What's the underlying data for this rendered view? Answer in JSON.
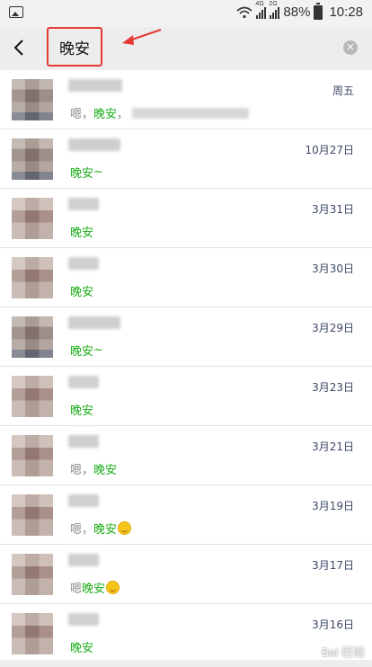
{
  "status_bar": {
    "battery": "88%",
    "time": "10:28",
    "network_labels": [
      "4G",
      "2G"
    ]
  },
  "search": {
    "query": "晚安"
  },
  "results": [
    {
      "date": "周五",
      "parts": [
        {
          "t": "嗯，",
          "h": false
        },
        {
          "t": "晚安",
          "h": true
        },
        {
          "t": "，",
          "h": false
        }
      ],
      "blurred_tail": true,
      "emoji": false,
      "avatar": "alt",
      "name_width": 60
    },
    {
      "date": "10月27日",
      "parts": [
        {
          "t": "晚安",
          "h": true
        },
        {
          "t": "~",
          "h": true
        }
      ],
      "blurred_tail": false,
      "emoji": false,
      "avatar": "alt",
      "name_width": 58
    },
    {
      "date": "3月31日",
      "parts": [
        {
          "t": "晚安",
          "h": true
        }
      ],
      "blurred_tail": false,
      "emoji": false,
      "avatar": "std",
      "name_width": 34
    },
    {
      "date": "3月30日",
      "parts": [
        {
          "t": "晚安",
          "h": true
        }
      ],
      "blurred_tail": false,
      "emoji": false,
      "avatar": "std",
      "name_width": 34
    },
    {
      "date": "3月29日",
      "parts": [
        {
          "t": "晚安",
          "h": true
        },
        {
          "t": "~",
          "h": true
        }
      ],
      "blurred_tail": false,
      "emoji": false,
      "avatar": "alt",
      "name_width": 58
    },
    {
      "date": "3月23日",
      "parts": [
        {
          "t": "晚安",
          "h": true
        }
      ],
      "blurred_tail": false,
      "emoji": false,
      "avatar": "std",
      "name_width": 34
    },
    {
      "date": "3月21日",
      "parts": [
        {
          "t": "嗯，",
          "h": false
        },
        {
          "t": "晚安",
          "h": true
        }
      ],
      "blurred_tail": false,
      "emoji": false,
      "avatar": "std",
      "name_width": 34
    },
    {
      "date": "3月19日",
      "parts": [
        {
          "t": "嗯，",
          "h": false
        },
        {
          "t": "晚安",
          "h": true
        }
      ],
      "blurred_tail": false,
      "emoji": true,
      "avatar": "std",
      "name_width": 34
    },
    {
      "date": "3月17日",
      "parts": [
        {
          "t": "嗯 ",
          "h": false
        },
        {
          "t": "晚安",
          "h": true
        }
      ],
      "blurred_tail": false,
      "emoji": true,
      "avatar": "std",
      "name_width": 34
    },
    {
      "date": "3月16日",
      "parts": [
        {
          "t": "晚安",
          "h": true
        }
      ],
      "blurred_tail": false,
      "emoji": false,
      "avatar": "std",
      "name_width": 34
    }
  ],
  "watermark": "Bai 经验"
}
